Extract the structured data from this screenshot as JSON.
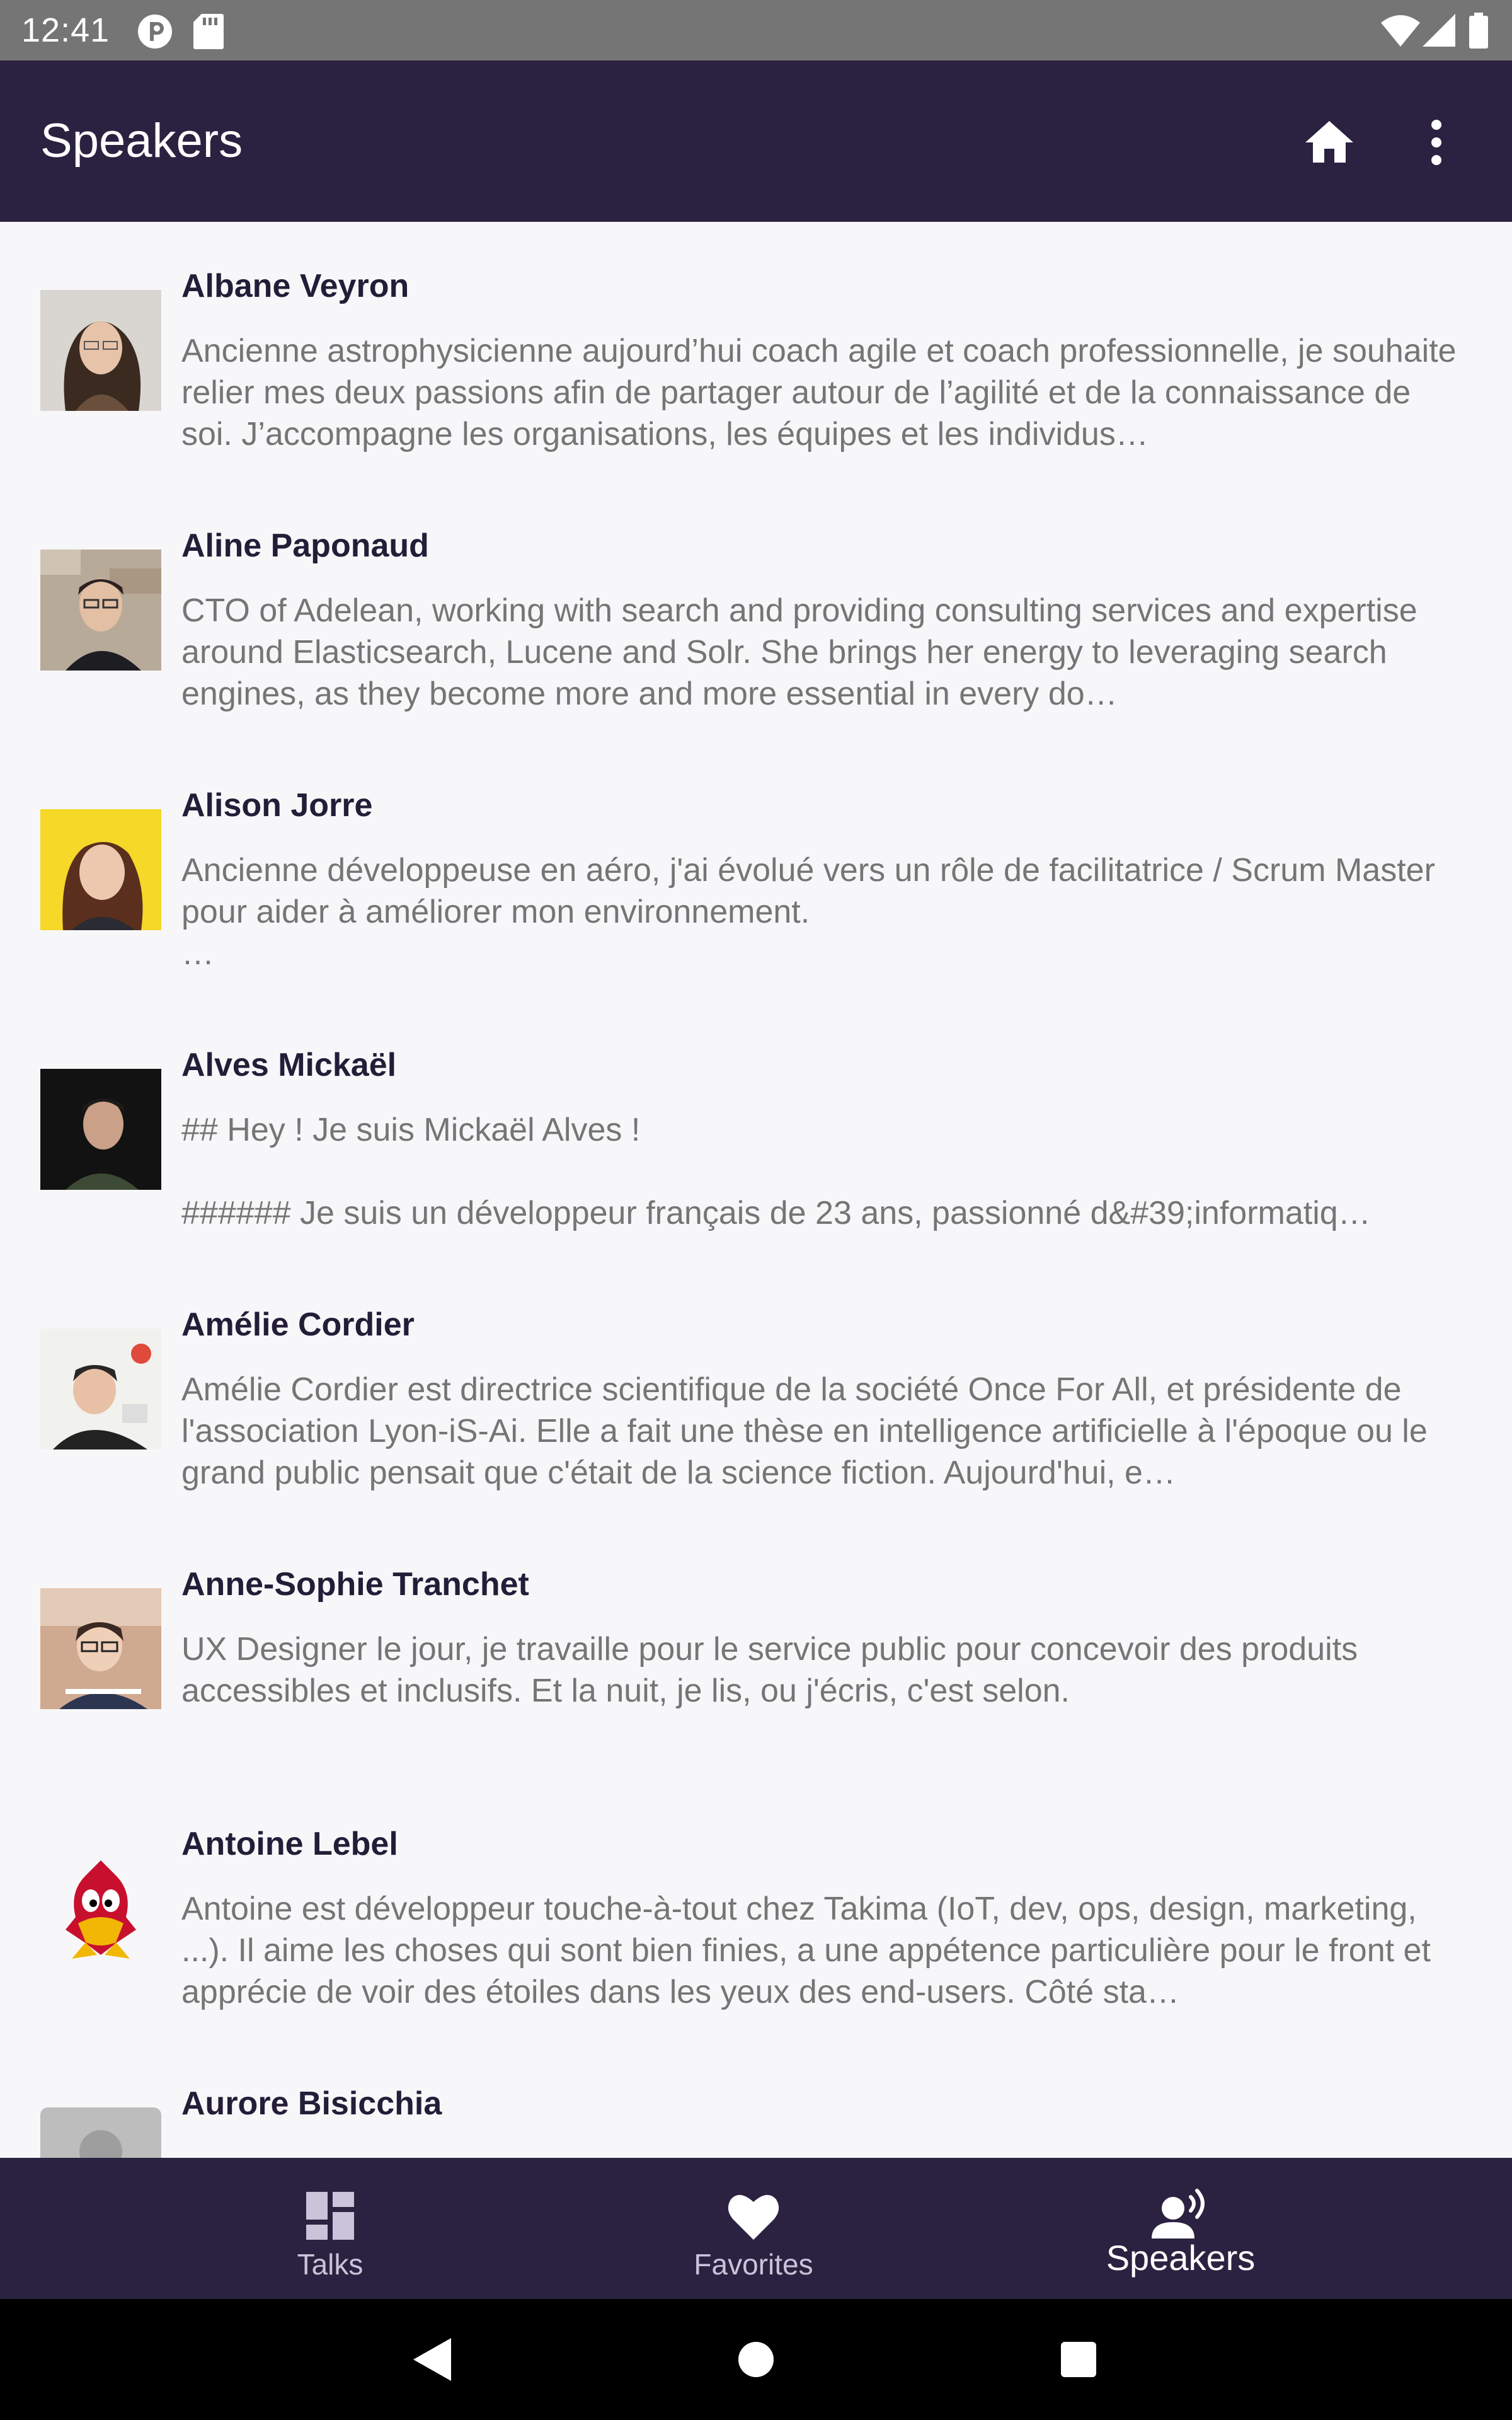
{
  "status_bar": {
    "time": "12:41"
  },
  "app_bar": {
    "title": "Speakers"
  },
  "speakers": [
    {
      "name": "Albane Veyron",
      "bio": "Ancienne astrophysicienne aujourd’hui coach agile et coach professionnelle, je souhaite relier mes deux passions afin de partager autour de l’agilité et de la connaissance de soi. J’accompagne les organisations, les équipes et les individus…"
    },
    {
      "name": "Aline Paponaud",
      "bio": "CTO of Adelean, working with search and providing consulting services and expertise around Elasticsearch, Lucene and Solr. She brings her energy to leveraging search engines, as they become more and more essential in every do…"
    },
    {
      "name": "Alison Jorre",
      "bio": "Ancienne développeuse en aéro, j'ai évolué vers un rôle de facilitatrice / Scrum Master pour aider à améliorer mon environnement.\n …"
    },
    {
      "name": "Alves Mickaël",
      "bio": "## Hey ! Je suis Mickaël Alves !\n\n###### Je suis un développeur français de 23 ans, passionné d&#39;informatiq…"
    },
    {
      "name": "Amélie Cordier",
      "bio": "Amélie Cordier est directrice scientifique de la société Once For All, et présidente de l'association Lyon-iS-Ai. Elle a fait une thèse en intelligence artificielle à l'époque ou le grand public pensait que c'était de la science fiction. Aujourd'hui, e…"
    },
    {
      "name": "Anne-Sophie Tranchet",
      "bio": "UX Designer le jour, je travaille pour le service public pour concevoir des produits accessibles et inclusifs. Et la nuit, je lis, ou j'écris, c'est selon."
    },
    {
      "name": "Antoine Lebel",
      "bio": "Antoine est développeur touche-à-tout chez Takima (IoT, dev, ops, design, marketing, ...). Il aime les choses qui sont bien finies, a une appétence particulière pour le front et apprécie de voir des étoiles dans les yeux des end-users. Côté sta…"
    },
    {
      "name": "Aurore Bisicchia",
      "bio": ""
    }
  ],
  "bottom_nav": {
    "talks": "Talks",
    "favorites": "Favorites",
    "speakers": "Speakers"
  },
  "colors": {
    "primary": "#2a2240",
    "name_text": "#241d38",
    "bio_text": "#757575",
    "background": "#f7f7f9"
  }
}
